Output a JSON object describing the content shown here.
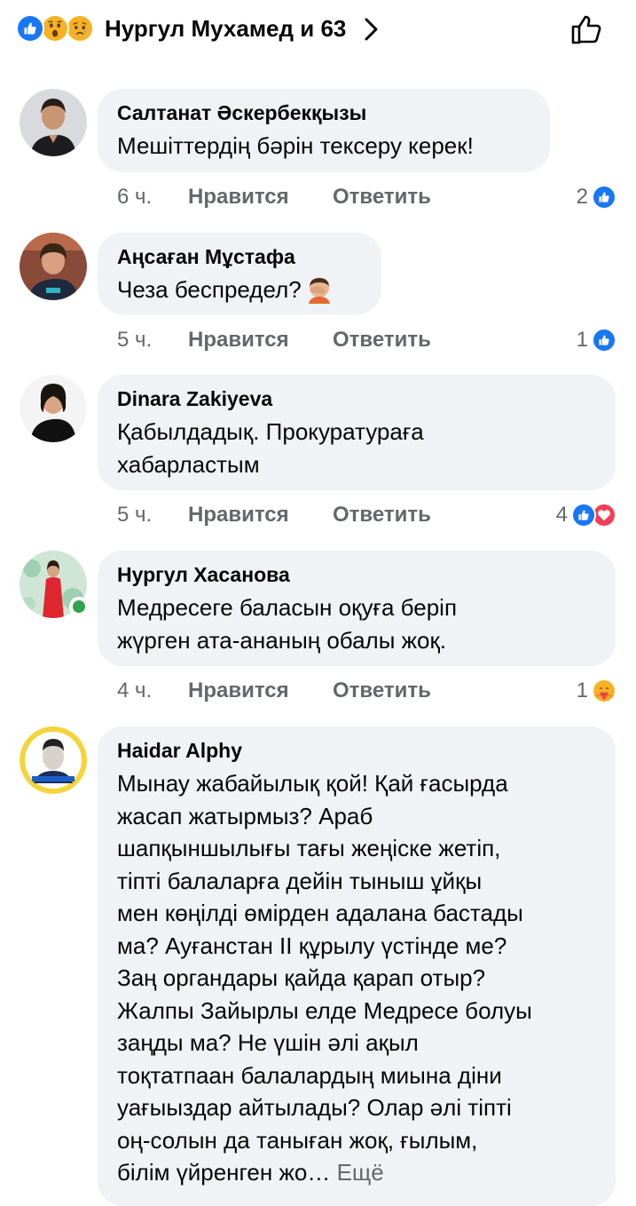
{
  "header": {
    "reaction_icons": [
      "like-icon",
      "wow-icon",
      "sad-icon"
    ],
    "title": "Нургул Мухамед и 63",
    "chevron_icon": "chevron-right-icon",
    "like_button_icon": "thumbs-up-outline-icon"
  },
  "labels": {
    "like": "Нравится",
    "reply": "Ответить"
  },
  "comments": [
    {
      "name": "Салтанат Әскербекқызы",
      "text": "Мешіттердің бәрін тексеру керек!",
      "time": "6 ч.",
      "reaction_count": "2",
      "reaction_icons": [
        "like-icon"
      ]
    },
    {
      "name": "Аңсаған Мұстафа",
      "text": "Чеза беспредел?",
      "emoji": "facepalm-emoji",
      "time": "5 ч.",
      "reaction_count": "1",
      "reaction_icons": [
        "like-icon"
      ]
    },
    {
      "name": "Dinara Zakiyeva",
      "text": "Қабылдадық. Прокуратураға\nхабарластым",
      "time": "5 ч.",
      "reaction_count": "4",
      "reaction_icons": [
        "like-icon",
        "love-icon"
      ]
    },
    {
      "name": "Нургул Хасанова",
      "text": "Медресеге баласын оқуға беріп\nжүрген ата-ананың обалы жоқ.",
      "time": "4 ч.",
      "reaction_count": "1",
      "reaction_icons": [
        "care-icon"
      ],
      "online": true
    },
    {
      "name": "Haidar Alphy",
      "text": "Мынау жабайылық қой! Қай ғасырда\nжасап жатырмыз? Араб\nшапқыншылығы тағы жеңіске жетіп,\nтіпті балаларға дейін тыныш ұйқы\nмен көңілді өмірден адалана бастады\nма? Ауғанстан II құрылу үстінде ме?\nЗаң органдары қайда қарап отыр?\nЖалпы Зайырлы елде Медресе болуы\nзаңды ма? Не үшін әлі ақыл\nтоқтатпаан балалардың миына діни\nуағыыздар айтылады? Олар әлі тіпті\nоң-солын да таныған жоқ, ғылым,\nбілім үйренген жо…",
      "more": "Ещё"
    }
  ],
  "colors": {
    "like_blue": "#1877f2",
    "love_red": "#f33e58",
    "care_yellow": "#f7b125",
    "bubble_bg": "#f0f2f5",
    "secondary_text": "#65676b",
    "online_green": "#31a24c"
  }
}
